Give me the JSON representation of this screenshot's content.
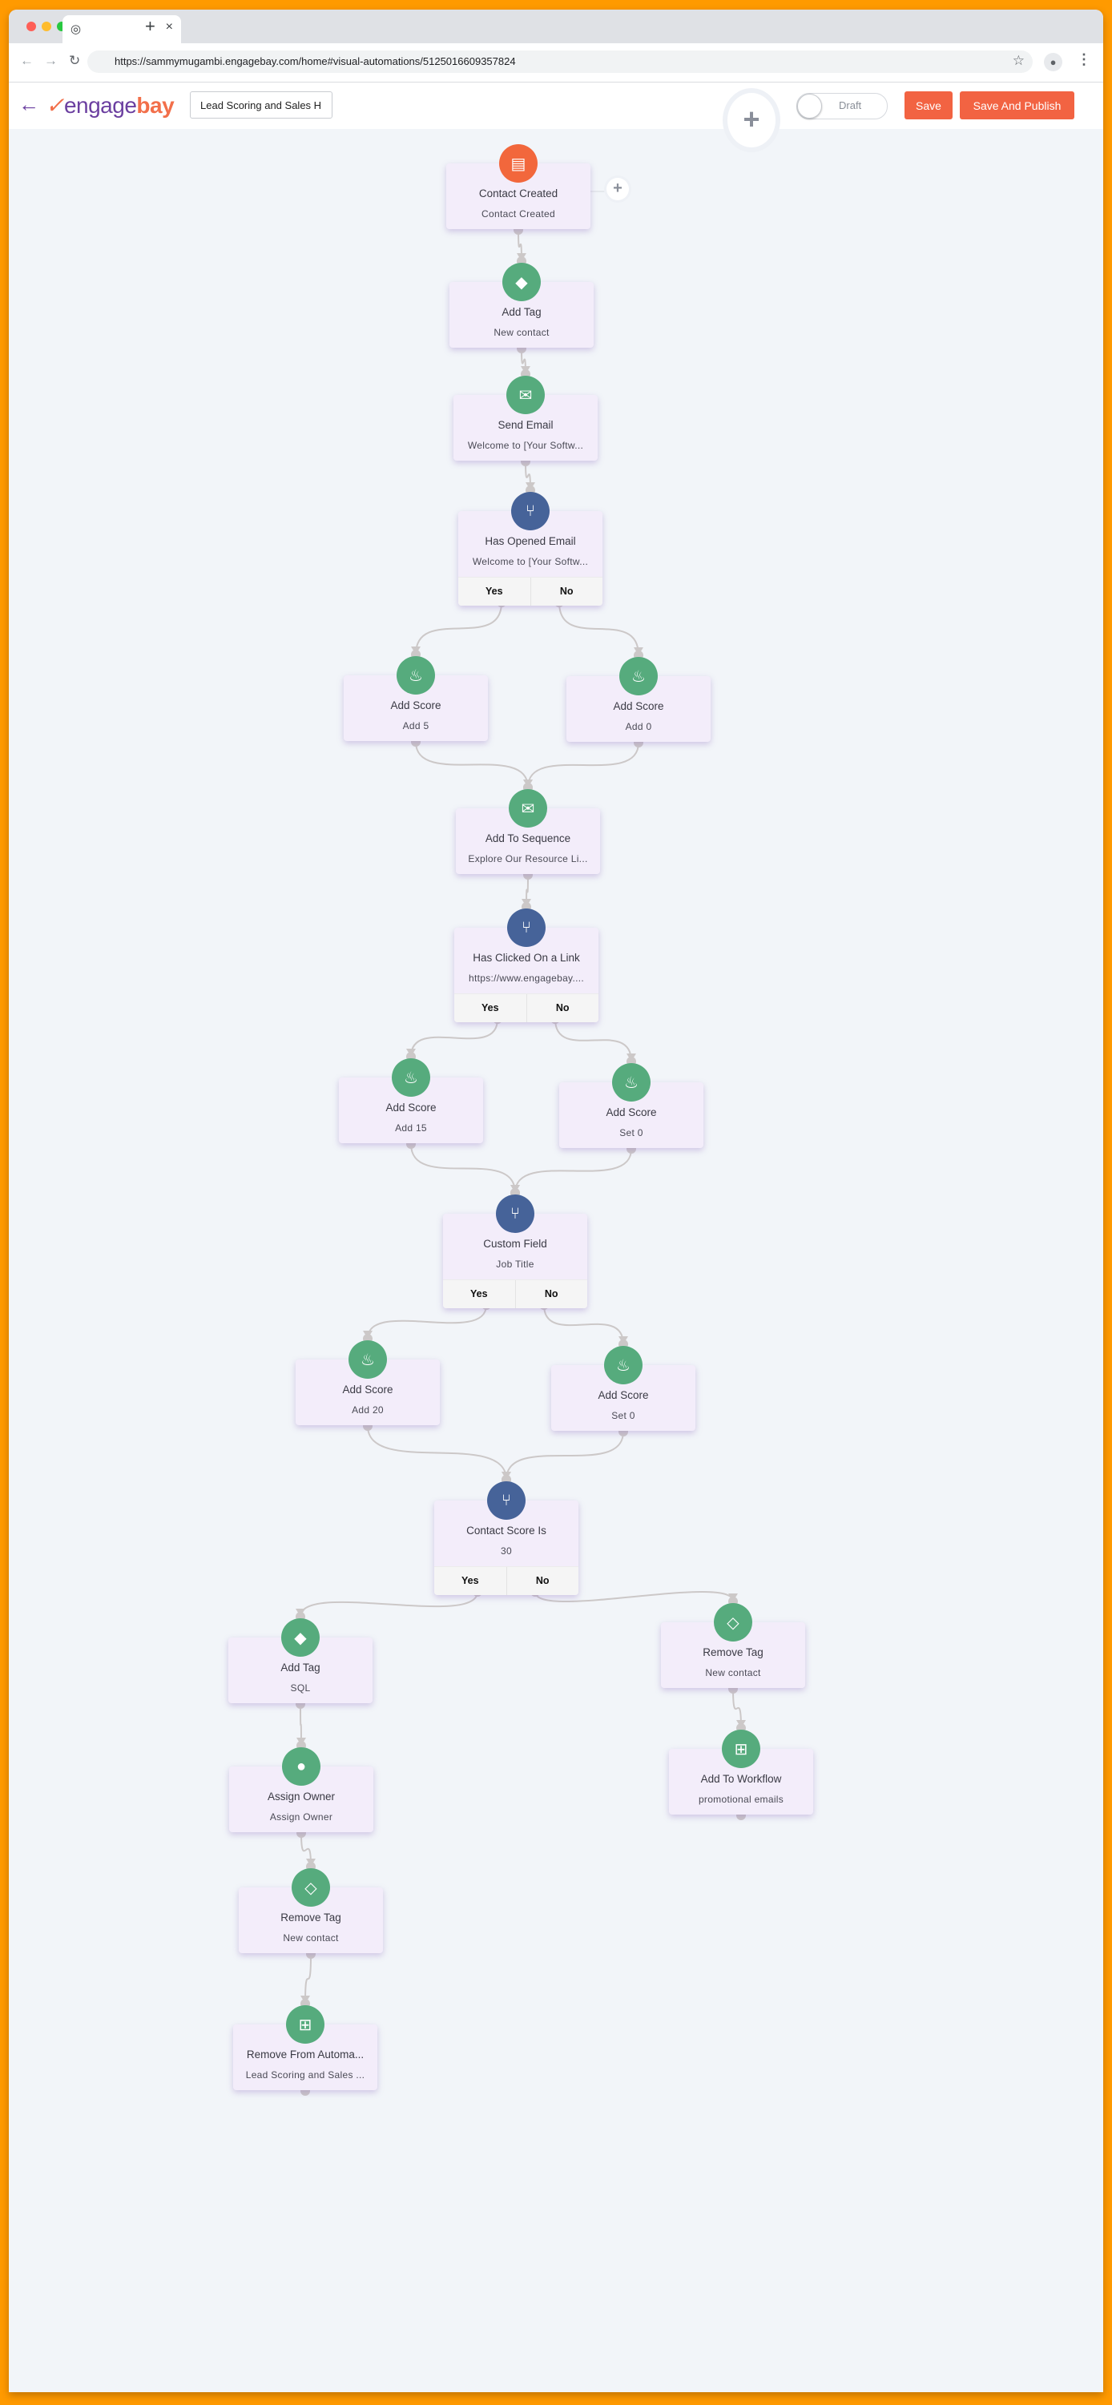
{
  "browser": {
    "url": "https://sammymugambi.engagebay.com/home#visual-automations/5125016609357824",
    "tab_close": "×",
    "new_tab": "+"
  },
  "app": {
    "back_label": "←",
    "logo": {
      "mark": "✓",
      "engage": "engage",
      "bay": "bay"
    },
    "automation_name": "Lead Scoring and Sales H",
    "status_toggle_label": "Draft",
    "status_active": false,
    "save_label": "Save",
    "save_publish_label": "Save And Publish",
    "add_node_label": "+"
  },
  "colors": {
    "accent": "#f26342",
    "action_green": "#56ab7d",
    "condition_blue": "#466399",
    "trigger_orange": "#f2673c",
    "node_bg": "#f3edfa",
    "canvas_bg": "#f2f5f9"
  },
  "nodes": [
    {
      "id": "n1",
      "type": "trigger",
      "icon": "newspaper-icon",
      "title": "Contact Created",
      "subtitle": "Contact Created"
    },
    {
      "id": "n2",
      "type": "action",
      "icon": "tag-icon",
      "title": "Add Tag",
      "subtitle": "New contact"
    },
    {
      "id": "n3",
      "type": "action",
      "icon": "envelope-icon",
      "title": "Send Email",
      "subtitle": "Welcome to [Your Softw..."
    },
    {
      "id": "n4",
      "type": "condition",
      "icon": "branch-icon",
      "title": "Has Opened Email",
      "subtitle": "Welcome to [Your Softw...",
      "yes": "Yes",
      "no": "No"
    },
    {
      "id": "n5",
      "type": "action",
      "icon": "flame-icon",
      "title": "Add Score",
      "subtitle": "Add 5"
    },
    {
      "id": "n6",
      "type": "action",
      "icon": "flame-icon",
      "title": "Add Score",
      "subtitle": "Add 0"
    },
    {
      "id": "n7",
      "type": "action",
      "icon": "envelope-icon",
      "title": "Add To Sequence",
      "subtitle": "Explore Our Resource Li..."
    },
    {
      "id": "n8",
      "type": "condition",
      "icon": "branch-icon",
      "title": "Has Clicked On a Link",
      "subtitle": "https://www.engagebay....",
      "yes": "Yes",
      "no": "No"
    },
    {
      "id": "n9",
      "type": "action",
      "icon": "flame-icon",
      "title": "Add Score",
      "subtitle": "Add 15"
    },
    {
      "id": "n10",
      "type": "action",
      "icon": "flame-icon",
      "title": "Add Score",
      "subtitle": "Set 0"
    },
    {
      "id": "n11",
      "type": "condition",
      "icon": "branch-icon",
      "title": "Custom Field",
      "subtitle": "Job Title",
      "yes": "Yes",
      "no": "No"
    },
    {
      "id": "n12",
      "type": "action",
      "icon": "flame-icon",
      "title": "Add Score",
      "subtitle": "Add 20"
    },
    {
      "id": "n13",
      "type": "action",
      "icon": "flame-icon",
      "title": "Add Score",
      "subtitle": "Set 0"
    },
    {
      "id": "n14",
      "type": "condition",
      "icon": "branch-icon",
      "title": "Contact Score Is",
      "subtitle": "30",
      "yes": "Yes",
      "no": "No"
    },
    {
      "id": "n15",
      "type": "action",
      "icon": "tag-icon",
      "title": "Add Tag",
      "subtitle": "SQL"
    },
    {
      "id": "n16",
      "type": "action",
      "icon": "eraser-icon",
      "title": "Remove Tag",
      "subtitle": "New contact"
    },
    {
      "id": "n17",
      "type": "action",
      "icon": "user-icon",
      "title": "Assign Owner",
      "subtitle": "Assign Owner"
    },
    {
      "id": "n18",
      "type": "action",
      "icon": "sitemap-icon",
      "title": "Add To Workflow",
      "subtitle": "promotional emails"
    },
    {
      "id": "n19",
      "type": "action",
      "icon": "eraser-icon",
      "title": "Remove Tag",
      "subtitle": "New contact"
    },
    {
      "id": "n20",
      "type": "action",
      "icon": "sitemap-icon",
      "title": "Remove From Automa...",
      "subtitle": "Lead Scoring and Sales ..."
    }
  ],
  "edges": [
    {
      "from": "n1",
      "to": "n2"
    },
    {
      "from": "n2",
      "to": "n3"
    },
    {
      "from": "n3",
      "to": "n4"
    },
    {
      "from": "n4",
      "branch": "yes",
      "to": "n5"
    },
    {
      "from": "n4",
      "branch": "no",
      "to": "n6"
    },
    {
      "from": "n5",
      "to": "n7"
    },
    {
      "from": "n6",
      "to": "n7"
    },
    {
      "from": "n7",
      "to": "n8"
    },
    {
      "from": "n8",
      "branch": "yes",
      "to": "n9"
    },
    {
      "from": "n8",
      "branch": "no",
      "to": "n10"
    },
    {
      "from": "n9",
      "to": "n11"
    },
    {
      "from": "n10",
      "to": "n11"
    },
    {
      "from": "n11",
      "branch": "yes",
      "to": "n12"
    },
    {
      "from": "n11",
      "branch": "no",
      "to": "n13"
    },
    {
      "from": "n12",
      "to": "n14"
    },
    {
      "from": "n13",
      "to": "n14"
    },
    {
      "from": "n14",
      "branch": "yes",
      "to": "n15"
    },
    {
      "from": "n14",
      "branch": "no",
      "to": "n16"
    },
    {
      "from": "n15",
      "to": "n17"
    },
    {
      "from": "n16",
      "to": "n18"
    },
    {
      "from": "n17",
      "to": "n19"
    },
    {
      "from": "n19",
      "to": "n20"
    }
  ],
  "trigger_add_label": "+"
}
